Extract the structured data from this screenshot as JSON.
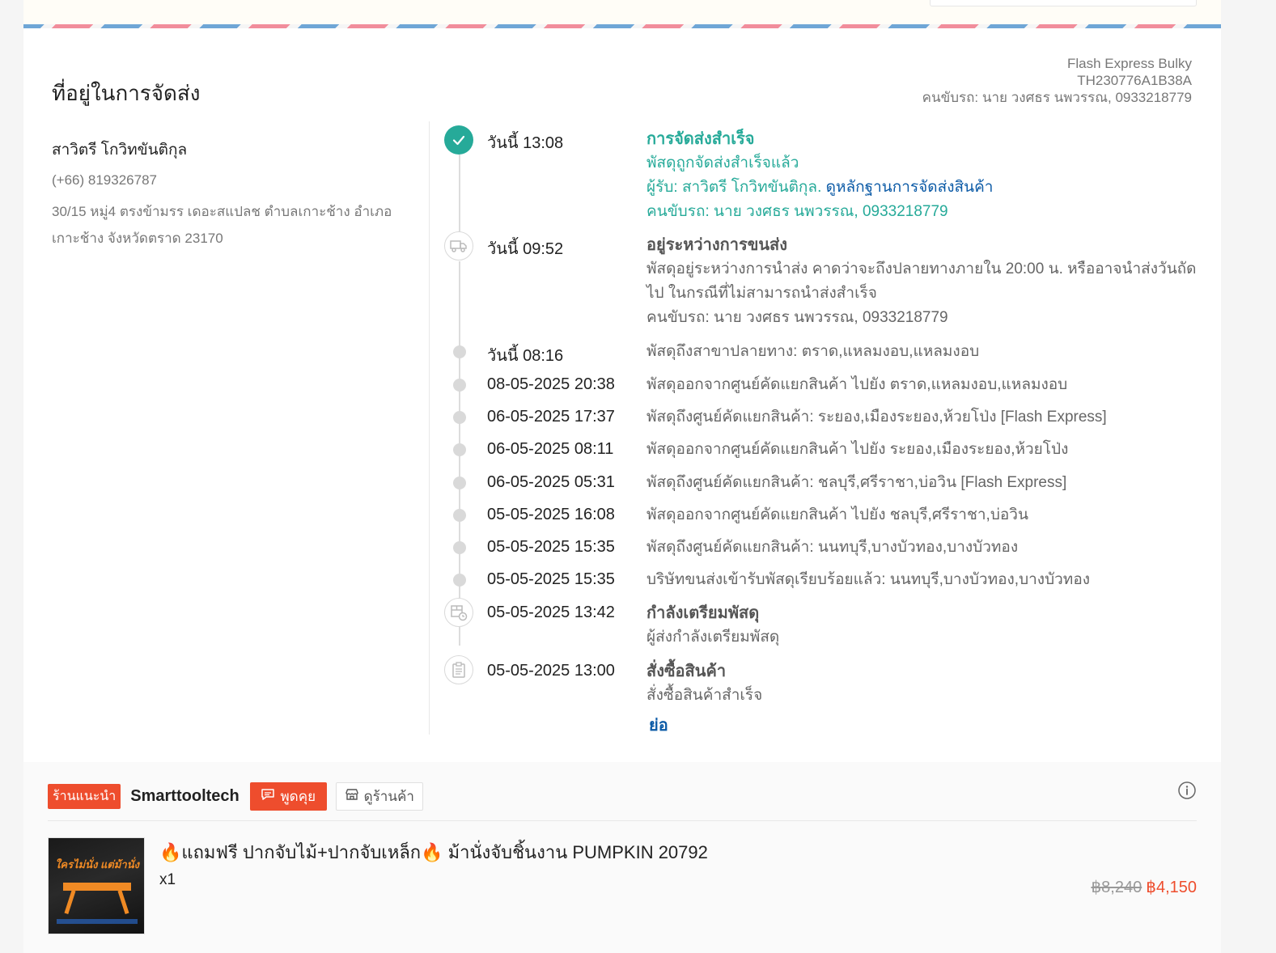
{
  "shipping": {
    "section_title": "ที่อยู่ในการจัดส่ง",
    "carrier": {
      "name": "Flash Express Bulky",
      "tracking": "TH230776A1B38A",
      "driver": "คนขับรถ: นาย วงศธร นพวรรณ, 0933218779"
    },
    "address": {
      "name": "สาวิตรี โกวิทขันติกุล",
      "phone": "(+66) 819326787",
      "line": "30/15 หมู่4 ตรงข้ามรร เดอะสแปลช ตำบลเกาะช้าง อำเภอเกาะช้าง จังหวัดตราด 23170"
    }
  },
  "timeline": {
    "events": [
      {
        "time": "วันนี้ 13:08",
        "title": "การจัดส่งสำเร็จ",
        "l1": "พัสดุถูกจัดส่งสำเร็จแล้ว",
        "l2": "ผู้รับ: สาวิตรี โกวิทขันติกุล.",
        "l2_link": "ดูหลักฐานการจัดส่งสินค้า",
        "l3": "คนขับรถ: นาย วงศธร นพวรรณ, 0933218779",
        "icon": "check-icon"
      },
      {
        "time": "วันนี้ 09:52",
        "title": "อยู่ระหว่างการขนส่ง",
        "l1": "พัสดุอยู่ระหว่างการนำส่ง คาดว่าจะถึงปลายทางภายใน 20:00 น. หรืออาจนำส่งวันถัดไป ในกรณีที่ไม่สามารถนำส่งสำเร็จ",
        "l2": "คนขับรถ: นาย วงศธร นพวรรณ, 0933218779",
        "icon": "truck-icon"
      },
      {
        "time": "วันนี้ 08:16",
        "text": "พัสดุถึงสาขาปลายทาง: ตราด,แหลมงอบ,แหลมงอบ"
      },
      {
        "time": "08-05-2025 20:38",
        "text": "พัสดุออกจากศูนย์คัดแยกสินค้า ไปยัง ตราด,แหลมงอบ,แหลมงอบ"
      },
      {
        "time": "06-05-2025 17:37",
        "text": "พัสดุถึงศูนย์คัดแยกสินค้า: ระยอง,เมืองระยอง,ห้วยโป่ง [Flash Express]"
      },
      {
        "time": "06-05-2025 08:11",
        "text": "พัสดุออกจากศูนย์คัดแยกสินค้า ไปยัง ระยอง,เมืองระยอง,ห้วยโป่ง"
      },
      {
        "time": "06-05-2025 05:31",
        "text": "พัสดุถึงศูนย์คัดแยกสินค้า: ชลบุรี,ศรีราชา,บ่อวิน [Flash Express]"
      },
      {
        "time": "05-05-2025 16:08",
        "text": "พัสดุออกจากศูนย์คัดแยกสินค้า ไปยัง ชลบุรี,ศรีราชา,บ่อวิน"
      },
      {
        "time": "05-05-2025 15:35",
        "text": "พัสดุถึงศูนย์คัดแยกสินค้า: นนทบุรี,บางบัวทอง,บางบัวทอง"
      },
      {
        "time": "05-05-2025 15:35",
        "text": "บริษัทขนส่งเข้ารับพัสดุเรียบร้อยแล้ว: นนทบุรี,บางบัวทอง,บางบัวทอง"
      },
      {
        "time": "05-05-2025 13:42",
        "title": "กำลังเตรียมพัสดุ",
        "l1": "ผู้ส่งกำลังเตรียมพัสดุ",
        "icon": "package-clock-icon"
      },
      {
        "time": "05-05-2025 13:00",
        "title": "สั่งซื้อสินค้า",
        "l1": "สั่งซื้อสินค้าสำเร็จ",
        "icon": "clipboard-icon"
      }
    ],
    "collapse_label": "ย่อ"
  },
  "shop": {
    "badge": "ร้านแนะนำ",
    "name": "Smarttooltech",
    "chat_label": "พูดคุย",
    "view_shop_label": "ดูร้านค้า"
  },
  "product": {
    "title": "🔥แถมฟรี ปากจับไม้+ปากจับเหล็ก🔥 ม้านั่งจับชิ้นงาน PUMPKIN 20792",
    "qty": "x1",
    "price_original": "฿8,240",
    "price_current": "฿4,150",
    "thumb_text": "ใครไม่นั่ง แต่ม้านั่ง"
  },
  "colors": {
    "accent": "#ee4d2d",
    "success": "#26aa99",
    "link": "#0b5aa6"
  }
}
